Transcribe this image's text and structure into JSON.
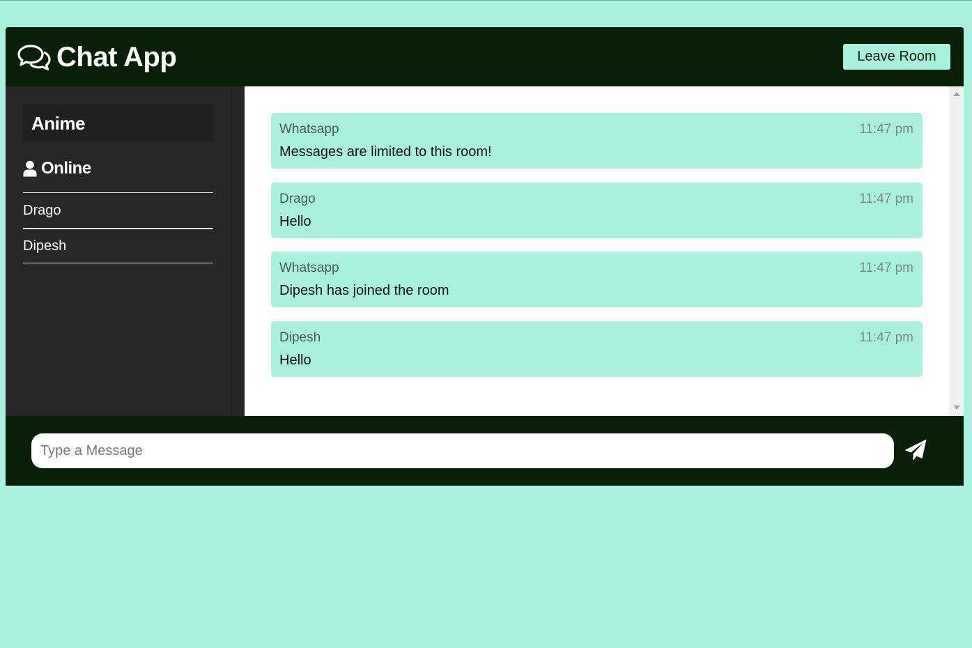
{
  "header": {
    "title": "Chat App",
    "leave_label": "Leave Room"
  },
  "sidebar": {
    "room_name": "Anime",
    "online_label": "Online",
    "users": [
      "Drago",
      "Dipesh"
    ]
  },
  "messages": [
    {
      "author": "Whatsapp",
      "time": "11:47 pm",
      "text": "Messages are limited to this room!"
    },
    {
      "author": "Drago",
      "time": "11:47 pm",
      "text": "Hello"
    },
    {
      "author": "Whatsapp",
      "time": "11:47 pm",
      "text": "Dipesh has joined the room"
    },
    {
      "author": "Dipesh",
      "time": "11:47 pm",
      "text": "Hello"
    }
  ],
  "composer": {
    "placeholder": "Type a Message",
    "value": ""
  },
  "colors": {
    "background": "#a9f1dc",
    "dark": "#0a1f07",
    "sidebar": "#272727",
    "message_bubble": "#a9f1dc"
  },
  "icons": {
    "logo": "comments-icon",
    "online": "user-icon",
    "send": "paper-plane-icon"
  }
}
